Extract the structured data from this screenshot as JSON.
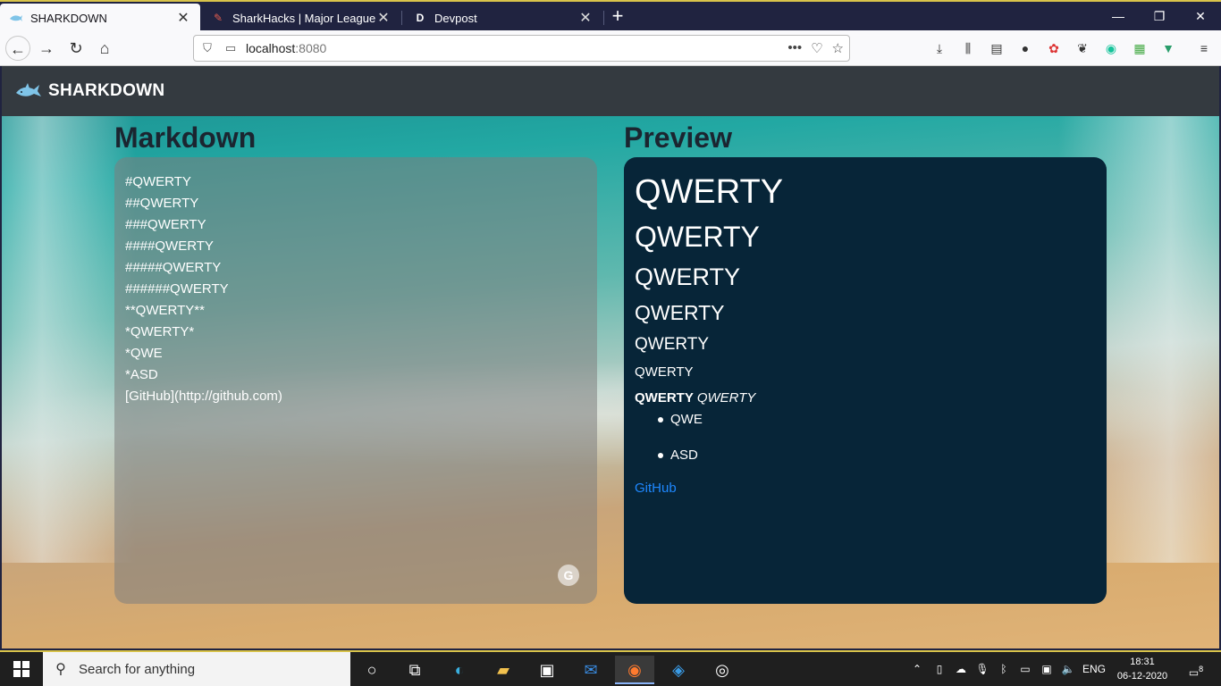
{
  "browser": {
    "tabs": [
      {
        "label": "SHARKDOWN",
        "active": true
      },
      {
        "label": "SharkHacks | Major League Hac",
        "active": false
      },
      {
        "label": "Devpost",
        "active": false
      }
    ],
    "url": {
      "host": "localhost",
      "port": ":8080"
    },
    "window_controls": {
      "minimize": "—",
      "restore": "❐",
      "close": "✕"
    }
  },
  "app": {
    "brand": "SHARKDOWN",
    "markdown_title": "Markdown",
    "preview_title": "Preview",
    "markdown_lines": [
      "#QWERTY",
      "##QWERTY",
      "###QWERTY",
      "####QWERTY",
      "#####QWERTY",
      "######QWERTY",
      "**QWERTY**",
      "*QWERTY*",
      "*QWE",
      "*ASD",
      "[GitHub](http://github.com)"
    ],
    "preview": {
      "h1": "QWERTY",
      "h2": "QWERTY",
      "h3": "QWERTY",
      "h4": "QWERTY",
      "h5": "QWERTY",
      "h6": "QWERTY",
      "bold": "QWERTY",
      "italic": "QWERTY",
      "list": [
        "QWE",
        "ASD"
      ],
      "link": "GitHub"
    },
    "colors": {
      "header": "#343a40",
      "preview_bg": "#072538",
      "link": "#1e88ff"
    }
  },
  "taskbar": {
    "search_placeholder": "Search for anything",
    "language": "ENG",
    "time": "18:31",
    "date": "06-12-2020",
    "notification_count": "8"
  }
}
